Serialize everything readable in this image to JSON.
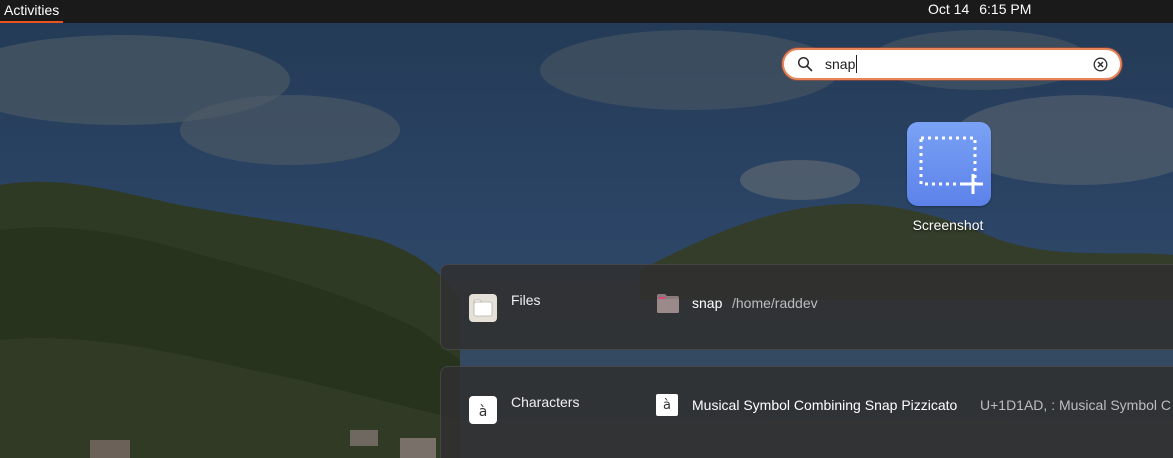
{
  "topbar": {
    "activities_label": "Activities",
    "date": "Oct 14",
    "time": "6:15 PM"
  },
  "search": {
    "query": "snap",
    "icon": "search-icon",
    "clear_icon": "clear-icon"
  },
  "apps": [
    {
      "label": "Screenshot",
      "icon": "screenshot-icon"
    }
  ],
  "providers": {
    "files": {
      "label": "Files",
      "icon": "files-folder-icon",
      "results": [
        {
          "title": "snap",
          "description": "/home/raddev",
          "icon": "folder-icon"
        }
      ]
    },
    "characters": {
      "label": "Characters",
      "icon": "characters-icon",
      "results": [
        {
          "title": "Musical Symbol Combining Snap Pizzicato",
          "description": "U+1D1AD, : Musical Symbol C",
          "icon": "character-glyph-icon"
        }
      ]
    }
  },
  "colors": {
    "accent": "#e95420",
    "topbar": "#1a1a1a",
    "panel": "#303030",
    "screenshot_icon": "#6a8ff0"
  }
}
